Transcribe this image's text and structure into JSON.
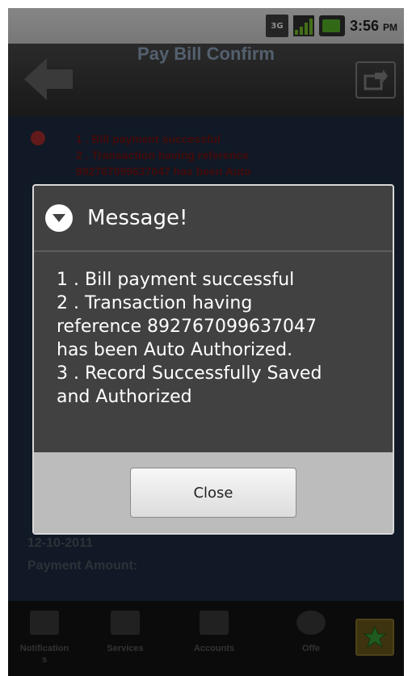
{
  "status_bar": {
    "network_label": "3G",
    "time": "3:56",
    "ampm": "PM"
  },
  "title_bar": {
    "title": "Pay Bill Confirm"
  },
  "background": {
    "error_lines": [
      "1 . Bill payment successful",
      "2 . Transaction having reference",
      "892767099637047 has been Auto"
    ],
    "date_value": "12-10-2011",
    "payment_amount_label": "Payment Amount:"
  },
  "dialog": {
    "title": "Message!",
    "lines": [
      "1 . Bill payment successful",
      "2 . Transaction having",
      "reference 892767099637047",
      "has been Auto Authorized.",
      "3 . Record Successfully Saved",
      "and Authorized"
    ],
    "close_label": "Close"
  },
  "tab_bar": {
    "items": [
      {
        "label": "Notification\ns"
      },
      {
        "label": "Services"
      },
      {
        "label": "Accounts"
      },
      {
        "label": "Offe"
      }
    ]
  },
  "colors": {
    "accent_star": "#3aa63a",
    "error_text": "#7c1414"
  },
  "icons": [
    "back-arrow-icon",
    "share-icon",
    "alert-icon",
    "chevron-down-icon",
    "star-icon"
  ]
}
